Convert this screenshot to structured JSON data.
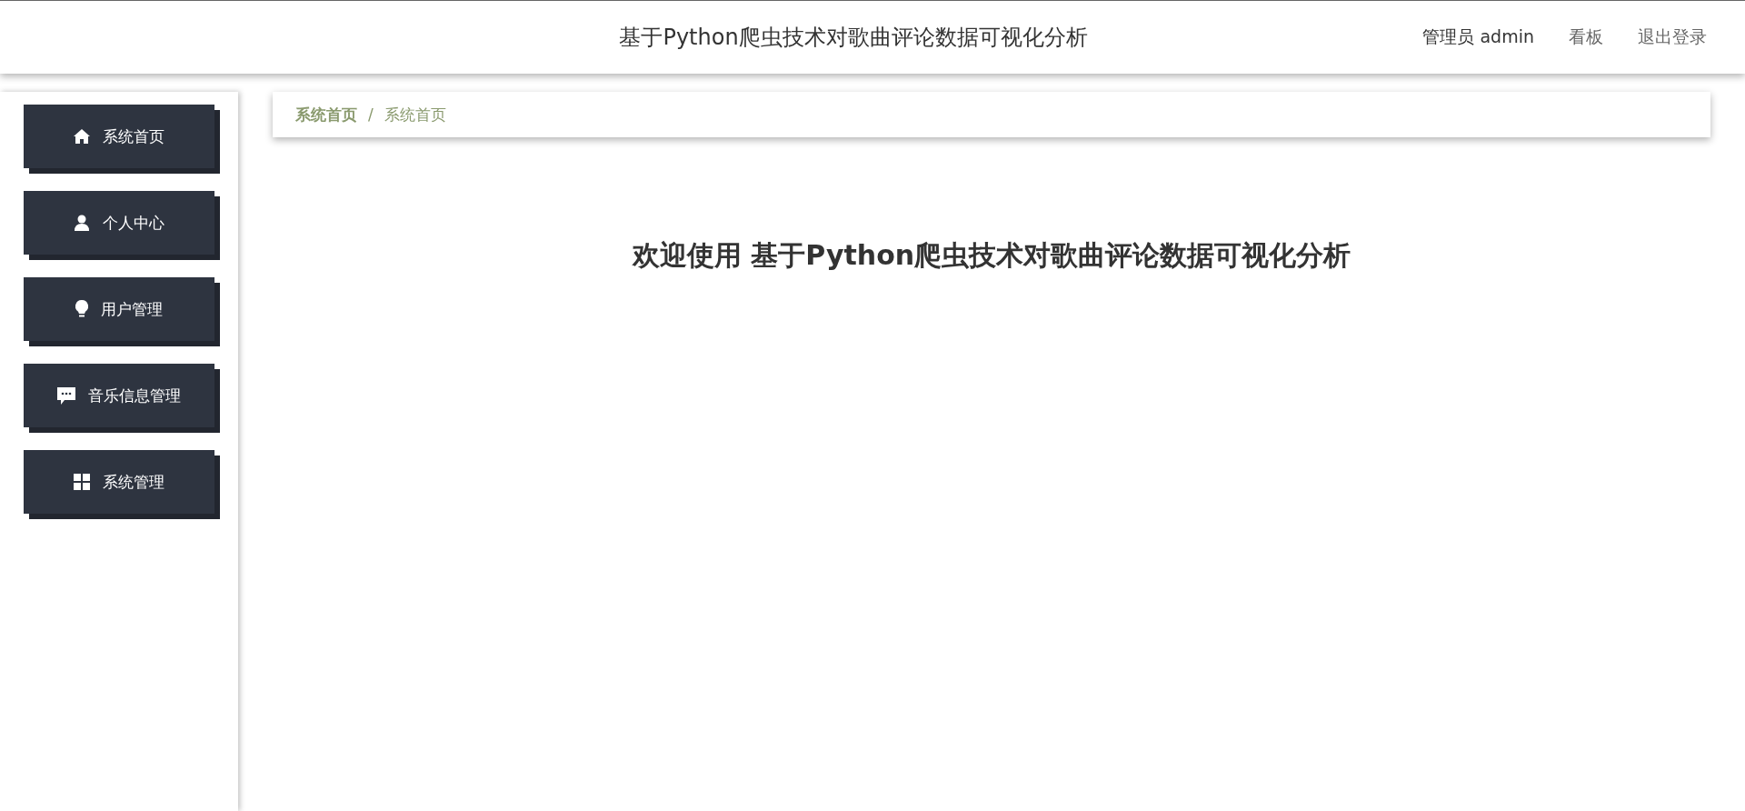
{
  "header": {
    "title": "基于Python爬虫技术对歌曲评论数据可视化分析",
    "user": "管理员 admin",
    "links": [
      "看板",
      "退出登录"
    ]
  },
  "sidebar": {
    "items": [
      {
        "label": "系统首页"
      },
      {
        "label": "个人中心"
      },
      {
        "label": "用户管理"
      },
      {
        "label": "音乐信息管理"
      },
      {
        "label": "系统管理"
      }
    ]
  },
  "breadcrumb": {
    "separator": "/",
    "items": [
      "系统首页",
      "系统首页"
    ]
  },
  "welcome": "欢迎使用 基于Python爬虫技术对歌曲评论数据可视化分析"
}
